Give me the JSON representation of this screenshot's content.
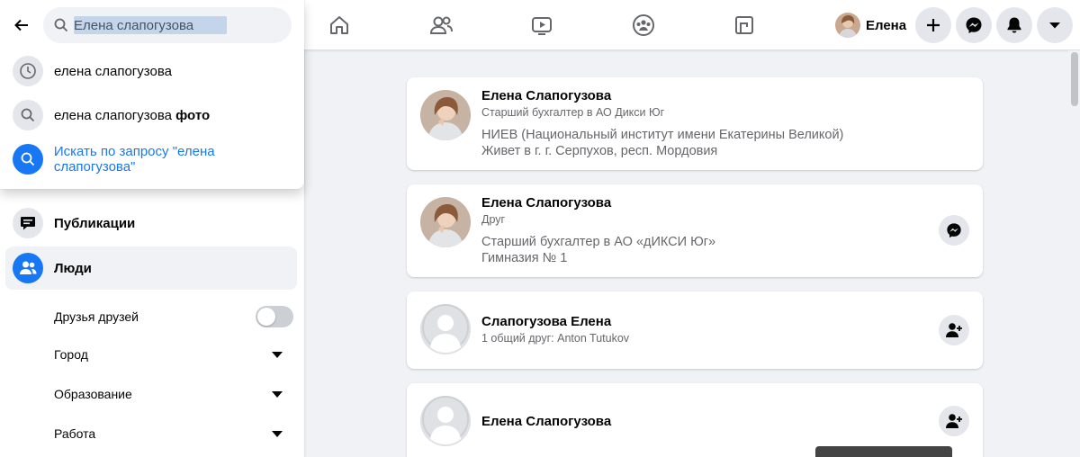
{
  "colors": {
    "accent": "#1877f2",
    "secondary_text": "#65676b",
    "surface": "#ffffff",
    "background": "#f0f2f5"
  },
  "search": {
    "value": "Елена слапогузова",
    "suggestions": [
      {
        "icon": "clock-icon",
        "text": "елена слапогузова"
      },
      {
        "icon": "search-icon",
        "text_plain": "елена слапогузова ",
        "text_bold": "фото"
      }
    ],
    "search_for_label": "Искать по запросу \"елена слапогузова\""
  },
  "topnav": {
    "icons": [
      "home-icon",
      "friends-icon",
      "watch-icon",
      "groups-icon",
      "gaming-icon"
    ],
    "profile_name": "Елена",
    "buttons": [
      "plus-icon",
      "messenger-icon",
      "bell-icon",
      "caret-down-icon"
    ]
  },
  "sidebar": {
    "items": [
      {
        "label": "Публикации",
        "icon": "posts-icon"
      },
      {
        "label": "Люди",
        "icon": "people-icon",
        "active": true
      }
    ],
    "filters": [
      {
        "label": "Друзья друзей",
        "control": "toggle",
        "on": false
      },
      {
        "label": "Город",
        "control": "dropdown"
      },
      {
        "label": "Образование",
        "control": "dropdown"
      },
      {
        "label": "Работа",
        "control": "dropdown"
      }
    ]
  },
  "results": [
    {
      "name": "Елена Слапогузова",
      "subtitle": "Старший бухгалтер в АО Дикси Юг",
      "line1": "НИЕВ (Национальный институт имени Екатерины Великой)",
      "line2": "Живет в г. г. Серпухов, респ. Мордовия",
      "action": ""
    },
    {
      "name": "Елена Слапогузова",
      "subtitle": "Друг",
      "line1": "Старший бухгалтер в АО «дИКСИ Юг»",
      "line2": "Гимназия № 1",
      "action": "messenger-icon"
    },
    {
      "name": "Слапогузова Елена",
      "subtitle": "1 общий друг: Anton Tutukov",
      "action": "add-friend-icon"
    },
    {
      "name": "Елена Слапогузова",
      "action": "add-friend-icon"
    }
  ]
}
